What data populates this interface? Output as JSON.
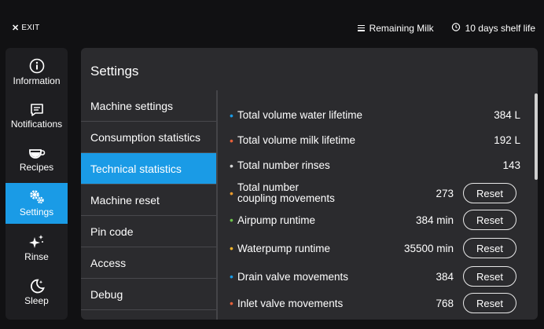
{
  "topbar": {
    "exit_label": "EXIT",
    "remaining_milk": "Remaining Milk",
    "shelf_life": "10 days shelf life"
  },
  "sidebar": {
    "items": [
      {
        "label": "Information",
        "icon": "info-icon"
      },
      {
        "label": "Notifications",
        "icon": "notification-icon"
      },
      {
        "label": "Recipes",
        "icon": "cup-icon"
      },
      {
        "label": "Settings",
        "icon": "gears-icon",
        "active": true
      },
      {
        "label": "Rinse",
        "icon": "sparkle-icon"
      },
      {
        "label": "Sleep",
        "icon": "moon-icon"
      }
    ]
  },
  "panel": {
    "title": "Settings",
    "menu": [
      "Machine settings",
      "Consumption statistics",
      "Technical statistics",
      "Machine reset",
      "Pin code",
      "Access",
      "Debug"
    ],
    "active_menu": "Technical statistics"
  },
  "stats": [
    {
      "label": "Total volume water lifetime",
      "value": "384 L",
      "dot_color": "#1a9be6",
      "reset": false
    },
    {
      "label": "Total volume milk lifetime",
      "value": "192 L",
      "dot_color": "#e5603a",
      "reset": false
    },
    {
      "label": "Total number rinses",
      "value": "143",
      "dot_color": "#d8d8d8",
      "reset": false
    },
    {
      "label_line1": "Total number",
      "label_line2": "coupling movements",
      "value": "273",
      "dot_color": "#e89a2c",
      "reset": true
    },
    {
      "label": "Airpump runtime",
      "value": "384 min",
      "dot_color": "#6cc24a",
      "reset": true
    },
    {
      "label": "Waterpump runtime",
      "value": "35500 min",
      "dot_color": "#f0b429",
      "reset": true
    },
    {
      "label": "Drain valve movements",
      "value": "384",
      "dot_color": "#1a9be6",
      "reset": true
    },
    {
      "label": "Inlet valve movements",
      "value": "768",
      "dot_color": "#e5603a",
      "reset": true
    }
  ],
  "reset_label": "Reset",
  "colors": {
    "accent": "#1a9be6",
    "background": "#111113",
    "panel": "#2b2b2e"
  }
}
